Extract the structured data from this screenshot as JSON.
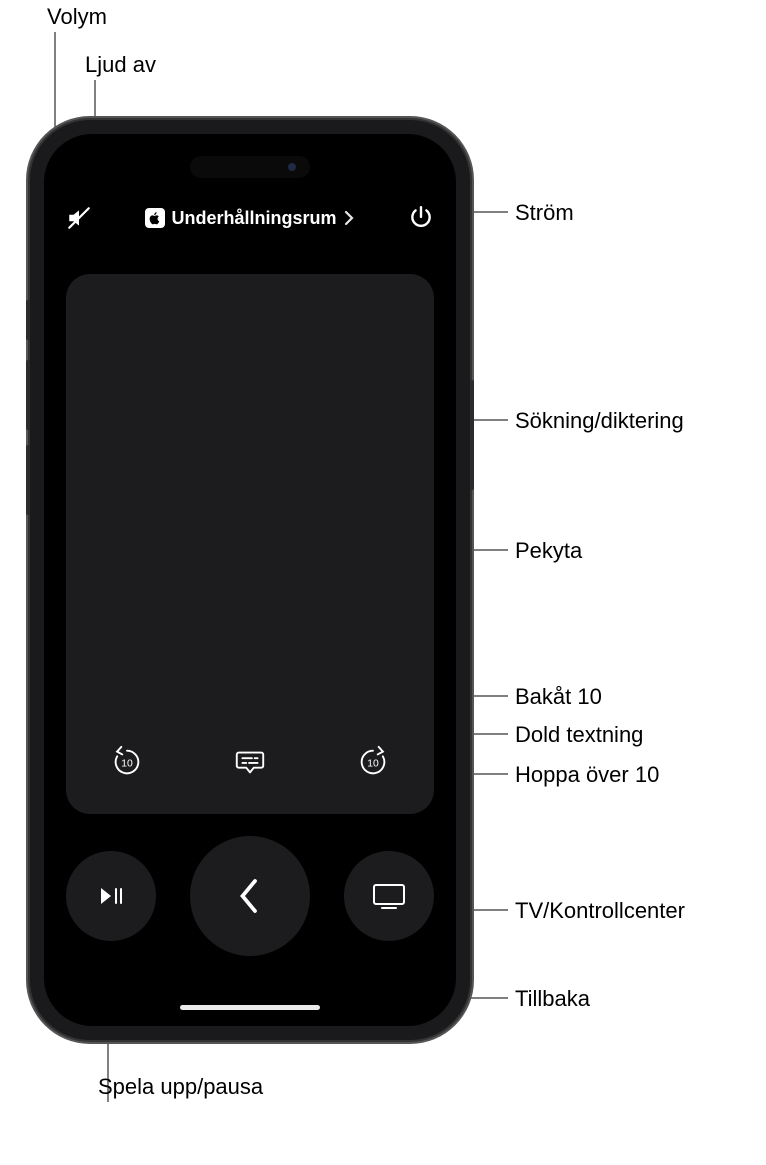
{
  "callouts": {
    "volume": "Volym",
    "muted": "Ljud av",
    "power": "Ström",
    "search": "Sökning/diktering",
    "touchpad": "Pekyta",
    "back10": "Bakåt 10",
    "captions": "Dold textning",
    "skip10": "Hoppa över 10",
    "tvcc": "TV/Kontrollcenter",
    "back": "Tillbaka",
    "playpause": "Spela upp/pausa"
  },
  "topbar": {
    "device_label": "Underhållningsrum"
  },
  "icons": {
    "skip_seconds": "10"
  }
}
